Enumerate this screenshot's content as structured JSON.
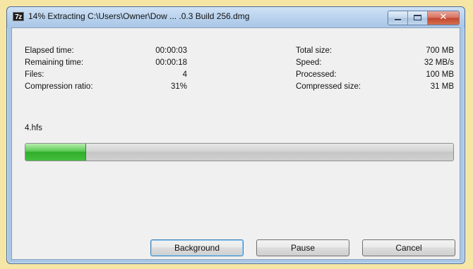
{
  "window": {
    "icon_text": "7z",
    "title": "14% Extracting C:\\Users\\Owner\\Dow ... .0.3 Build 256.dmg"
  },
  "stats": {
    "elapsed_label": "Elapsed time:",
    "elapsed_value": "00:00:03",
    "remaining_label": "Remaining time:",
    "remaining_value": "00:00:18",
    "files_label": "Files:",
    "files_value": "4",
    "ratio_label": "Compression ratio:",
    "ratio_value": "31%",
    "total_size_label": "Total size:",
    "total_size_value": "700 MB",
    "speed_label": "Speed:",
    "speed_value": "32 MB/s",
    "processed_label": "Processed:",
    "processed_value": "100 MB",
    "compressed_label": "Compressed size:",
    "compressed_value": "31 MB"
  },
  "current_file": "4.hfs",
  "progress": {
    "fraction": 0.14,
    "fill_color": "#3cb935"
  },
  "buttons": {
    "background": "Background",
    "pause": "Pause",
    "cancel": "Cancel"
  },
  "icons": {
    "minimize": "minimize-icon",
    "maximize": "maximize-icon",
    "close": "close-icon"
  },
  "colors": {
    "desktop": "#f6e6a6",
    "frame": "#a9c7e6",
    "close_button": "#c2452d"
  }
}
